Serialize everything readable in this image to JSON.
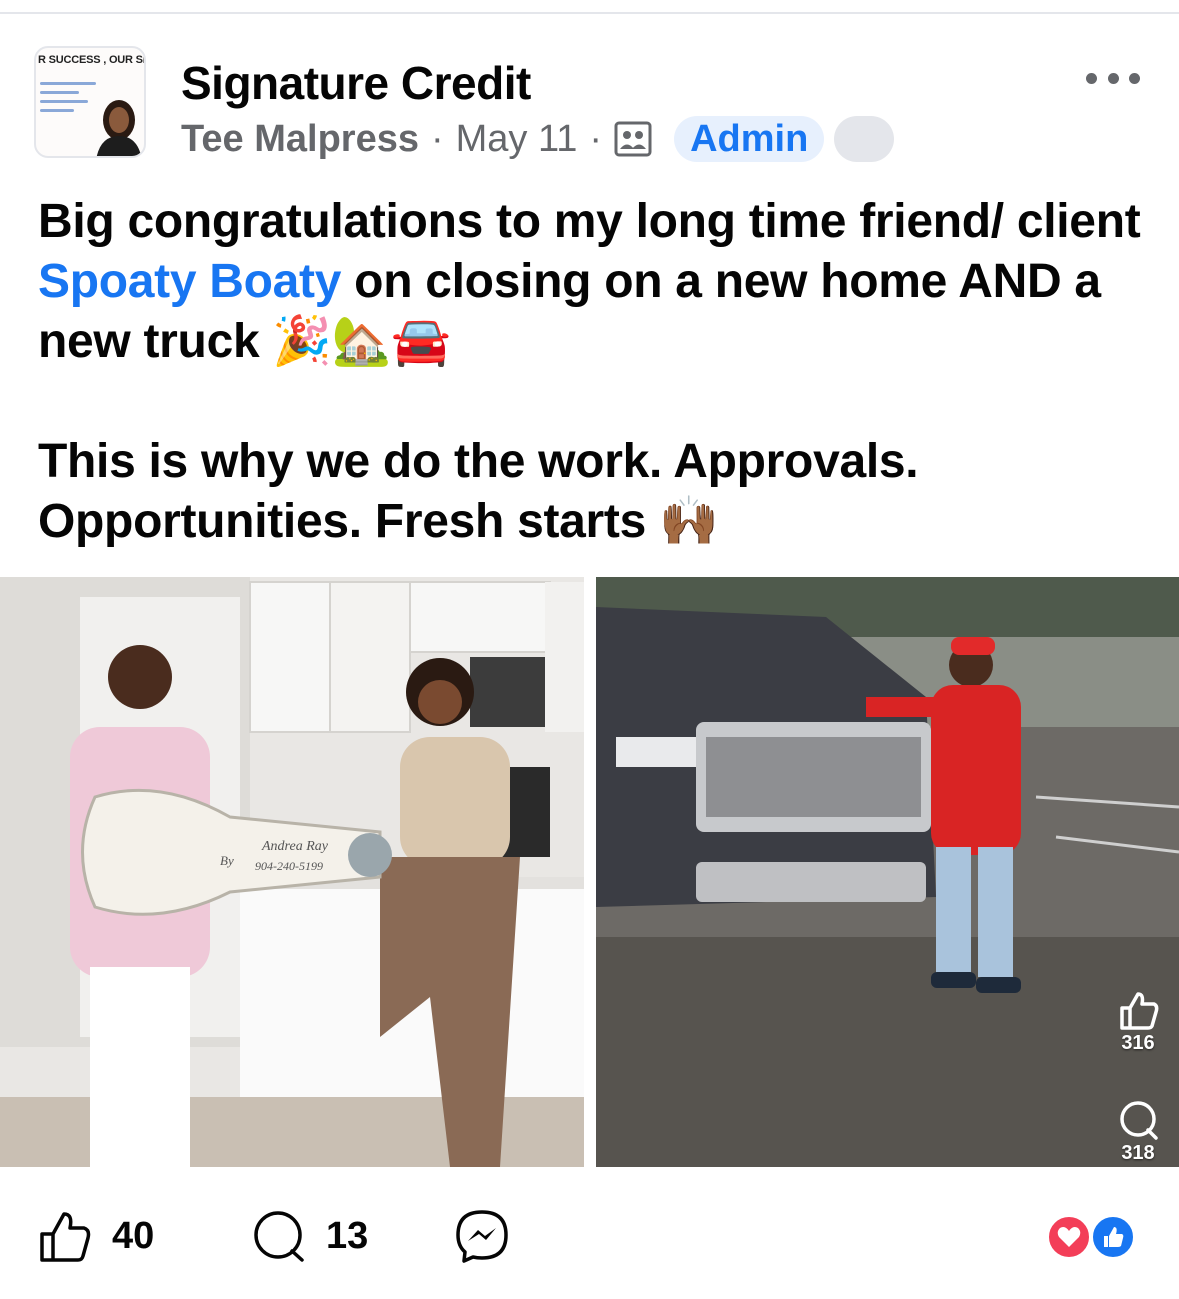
{
  "header": {
    "avatar_banner": "R SUCCESS , OUR SIGNAT",
    "group_name": "Signature Credit",
    "author": "Tee Malpress",
    "separator": "·",
    "date": "May 11",
    "role_badge": "Admin"
  },
  "post": {
    "line1_before": "Big congratulations to my long time friend/ client ",
    "mention": "Spoaty Boaty",
    "line1_after": " on closing on a new home AND a new truck 🎉🏡🚘",
    "line2": "This is why we do the work. Approvals. Opportunities. Fresh starts 🙌🏾"
  },
  "photos": {
    "left_key_text": "Andrea Ray",
    "left_key_by": "By",
    "left_key_phone": "904-240-5199",
    "right_overlay_likes": "316",
    "right_overlay_comments": "318"
  },
  "footer": {
    "likes": "40",
    "comments": "13"
  },
  "icons": {
    "more": "more-dots-icon",
    "members": "members-icon",
    "like": "thumbs-up-icon",
    "comment": "comment-bubble-icon",
    "share": "messenger-icon",
    "love_reaction": "heart-reaction-icon",
    "like_reaction": "like-reaction-icon"
  },
  "colors": {
    "accent": "#1876f2",
    "secondary_text": "#65676b",
    "admin_badge_bg": "#e7f0fd",
    "love": "#f33e58"
  }
}
